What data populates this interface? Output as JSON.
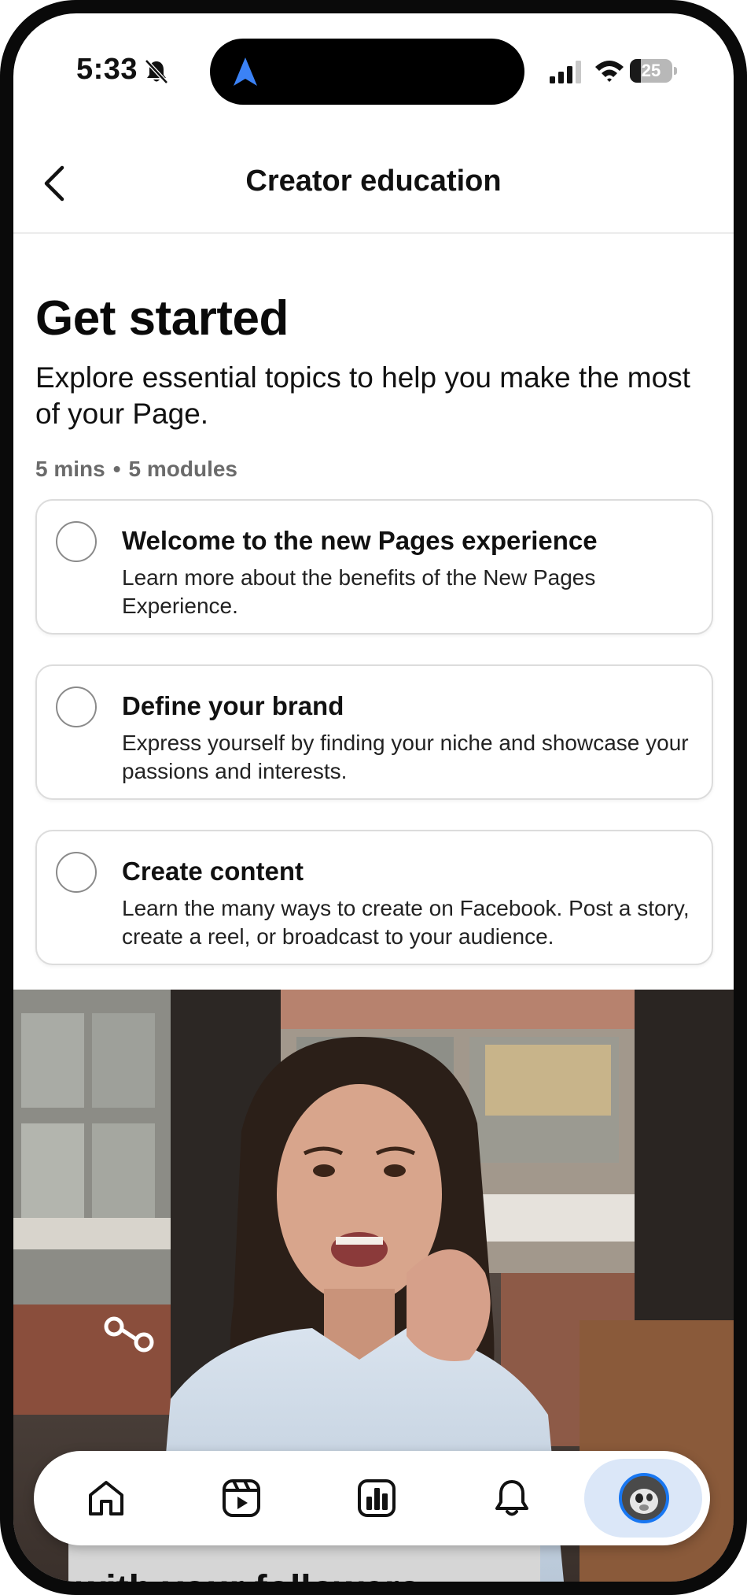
{
  "status_bar": {
    "time": "5:33",
    "battery": "25",
    "battery_level": 0.25,
    "icons": [
      "bell-mute-icon",
      "location-arrow-icon",
      "signal-icon",
      "wifi-icon",
      "battery-icon"
    ]
  },
  "header": {
    "title": "Creator education",
    "back_icon": "chevron-left-icon"
  },
  "intro": {
    "heading": "Get started",
    "description": "Explore essential topics to help you make the most of your Page.",
    "duration": "5 mins",
    "separator": "•",
    "modules": "5 modules"
  },
  "modules": [
    {
      "title": "Welcome to the new Pages experience",
      "text": "Learn more about the benefits of the New Pages Experience.",
      "completed": false
    },
    {
      "title": "Define your brand",
      "text": "Express yourself by finding your niche and showcase your passions and interests.",
      "completed": false
    },
    {
      "title": "Create content",
      "text": "Learn the many ways to create on Facebook. Post a story, create a reel, or broadcast to your audience.",
      "completed": false
    }
  ],
  "video": {
    "caption_line2": "with your followers"
  },
  "tab_bar": {
    "tabs": [
      "home-icon",
      "reels-icon",
      "insights-icon",
      "notifications-icon",
      "profile-avatar"
    ],
    "active": "profile-avatar",
    "active_color": "#dbe7f8",
    "accent": "#1877f2"
  }
}
